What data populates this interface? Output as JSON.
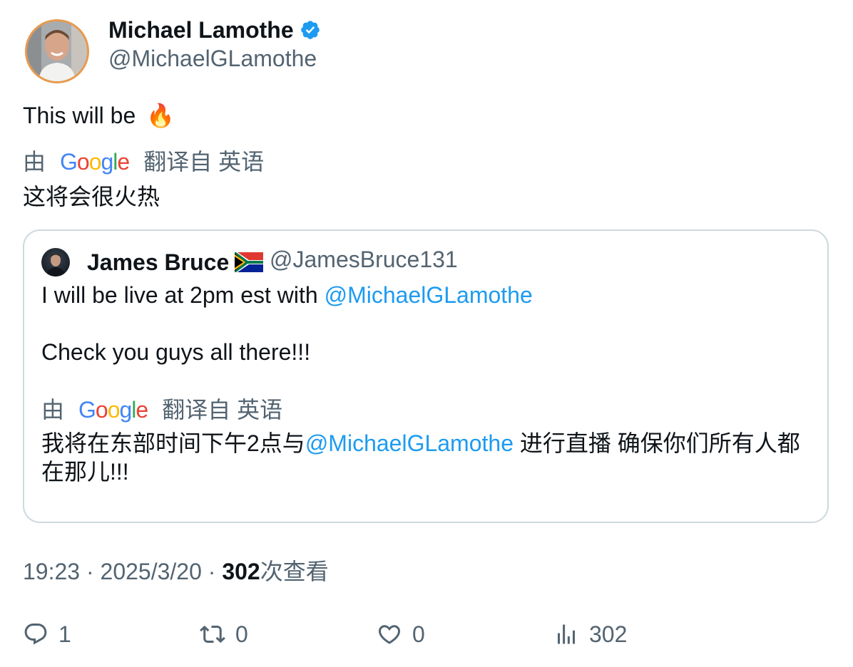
{
  "author": {
    "name": "Michael Lamothe",
    "handle": "@MichaelGLamothe",
    "verified": true
  },
  "tweet": {
    "text": "This will be",
    "emoji": "🔥",
    "translation_prefix": "由",
    "translation_suffix": "翻译自 英语",
    "translated_text": "这将会很火热"
  },
  "quote": {
    "name": "James Bruce",
    "flag": "south-africa-flag",
    "handle": "@JamesBruce131",
    "line1_prefix": "I will be live at 2pm est with ",
    "line1_mention": "@MichaelGLamothe",
    "line2": "Check you guys all there!!!",
    "translation_prefix": "由",
    "translation_suffix": "翻译自 英语",
    "translated_prefix": "我将在东部时间下午2点与",
    "translated_mention": "@MichaelGLamothe",
    "translated_suffix": " 进行直播 确保你们所有人都在那儿!!!"
  },
  "meta": {
    "time": "19:23",
    "date": "2025/3/20",
    "views_count": "302",
    "views_label": "次查看"
  },
  "actions": {
    "replies": "1",
    "reposts": "0",
    "likes": "0",
    "views": "302"
  },
  "colors": {
    "text": "#0f1419",
    "secondary": "#536471",
    "link": "#1d9bf0",
    "border": "#cfd9de"
  }
}
